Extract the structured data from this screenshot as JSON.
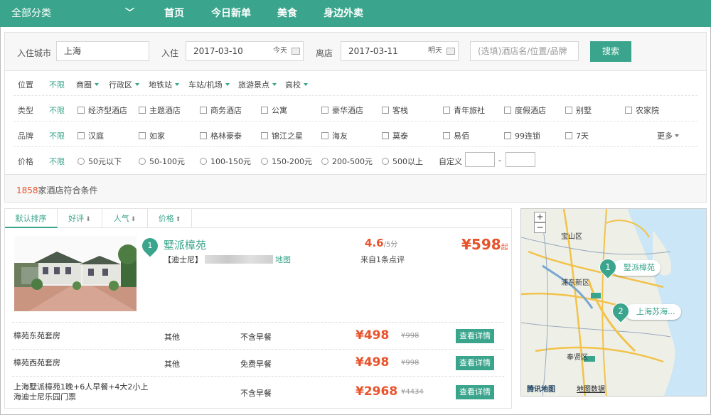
{
  "topnav": {
    "category": "全部分类",
    "links": [
      "首页",
      "今日新单",
      "美食",
      "身边外卖"
    ]
  },
  "search": {
    "city_label": "入住城市",
    "city_value": "上海",
    "checkin_label": "入住",
    "checkin_value": "2017-03-10",
    "checkin_hint": "今天",
    "checkout_label": "离店",
    "checkout_value": "2017-03-11",
    "checkout_hint": "明天",
    "keyword_placeholder": "(选填)酒店名/位置/品牌",
    "button": "搜索"
  },
  "filters": {
    "all": "不限",
    "location": {
      "title": "位置",
      "options": [
        "商圈",
        "行政区",
        "地铁站",
        "车站/机场",
        "旅游景点",
        "高校"
      ]
    },
    "type": {
      "title": "类型",
      "options": [
        "经济型酒店",
        "主题酒店",
        "商务酒店",
        "公寓",
        "豪华酒店",
        "客栈",
        "青年旅社",
        "度假酒店",
        "别墅",
        "农家院"
      ]
    },
    "brand": {
      "title": "品牌",
      "options": [
        "汉庭",
        "如家",
        "格林豪泰",
        "锦江之星",
        "海友",
        "莫泰",
        "易佰",
        "99连锁",
        "7天"
      ],
      "more": "更多"
    },
    "price": {
      "title": "价格",
      "options": [
        "50元以下",
        "50-100元",
        "100-150元",
        "150-200元",
        "200-500元",
        "500以上"
      ],
      "custom_label": "自定义",
      "separator": "-"
    }
  },
  "count": {
    "number": "1858",
    "text": "家酒店符合条件"
  },
  "sort_tabs": [
    "默认排序",
    "好评",
    "人气",
    "价格"
  ],
  "sort_arrows": [
    "",
    "⬇",
    "⬇",
    "⬆"
  ],
  "hotel": {
    "index": "1",
    "name": "墅派樟苑",
    "area": "【迪士尼】",
    "map_link": "地图",
    "score": "4.6",
    "score_suffix": "/5分",
    "reviews": "来自1条点评",
    "price": "¥598",
    "price_suffix": "起",
    "rooms": [
      {
        "name": "樟苑东苑套房",
        "type": "其他",
        "breakfast": "不含早餐",
        "price": "¥498",
        "original": "¥998",
        "button": "查看详情"
      },
      {
        "name": "樟苑西苑套房",
        "type": "其他",
        "breakfast": "免费早餐",
        "price": "¥498",
        "original": "¥998",
        "button": "查看详情"
      },
      {
        "name_line1": "上海墅派樟苑1晚+6人早餐+4大2小上",
        "name_line2": "海迪士尼乐园门票",
        "type": "",
        "breakfast": "不含早餐",
        "price": "¥2968",
        "original": "¥4434",
        "button": "查看详情"
      }
    ]
  },
  "map": {
    "zoom_in": "+",
    "zoom_out": "−",
    "labels": [
      "宝山区",
      "浦东新区",
      "奉贤区"
    ],
    "markers": [
      {
        "num": "1",
        "label": "墅派樟苑"
      },
      {
        "num": "2",
        "label": "上海苏海..."
      }
    ],
    "logo": "腾讯地图",
    "data_link": "地图数据"
  }
}
